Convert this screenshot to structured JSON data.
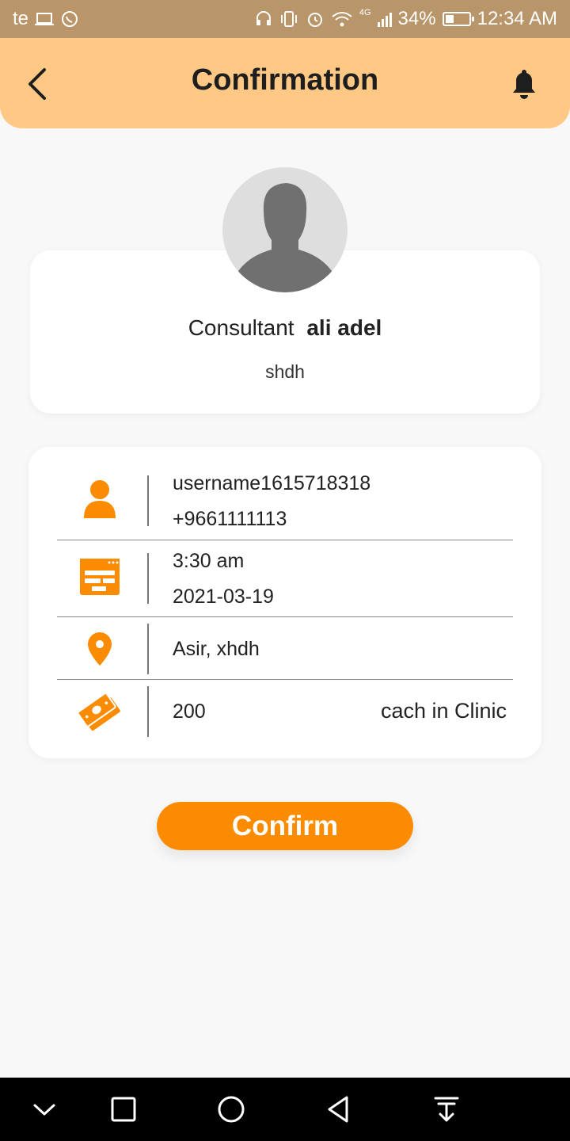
{
  "status_bar": {
    "carrier": "te",
    "network": "4G",
    "battery": "34%",
    "time": "12:34 AM"
  },
  "header": {
    "title": "Confirmation"
  },
  "consultant": {
    "role": "Consultant",
    "name": "ali adel",
    "subtitle": "shdh"
  },
  "details": {
    "username": "username1615718318",
    "phone": "+9661111113",
    "time": "3:30 am",
    "date": "2021-03-19",
    "location": "Asir, xhdh",
    "price": "200",
    "payment_method": "cach in Clinic"
  },
  "confirm_button": {
    "label": "Confirm"
  },
  "colors": {
    "accent": "#fb8b00",
    "header_bg": "#ffc985",
    "status_bar_bg": "#b9956a"
  }
}
